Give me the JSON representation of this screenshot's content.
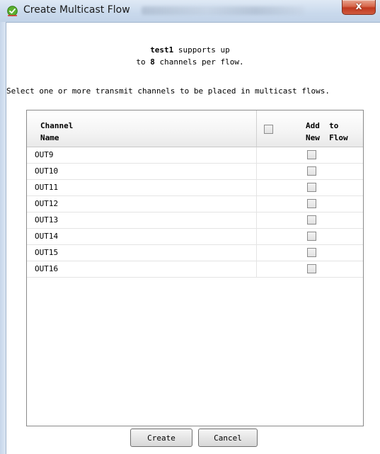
{
  "window": {
    "title": "Create Multicast Flow",
    "close_label": "x",
    "icon": "check-badge-icon"
  },
  "info": {
    "device_name": "test1",
    "line1_suffix": " supports up",
    "line2_prefix": "to ",
    "channel_limit": "8",
    "line2_suffix": " channels per flow."
  },
  "instruction": "Select one or more transmit channels to be placed in multicast flows.",
  "table": {
    "col_channel": "Channel\nName",
    "col_add_line1": "Add  to",
    "col_add_line2": "New  Flow",
    "rows": [
      {
        "name": "OUT9",
        "checked": false
      },
      {
        "name": "OUT10",
        "checked": false
      },
      {
        "name": "OUT11",
        "checked": false
      },
      {
        "name": "OUT12",
        "checked": false
      },
      {
        "name": "OUT13",
        "checked": false
      },
      {
        "name": "OUT14",
        "checked": false
      },
      {
        "name": "OUT15",
        "checked": false
      },
      {
        "name": "OUT16",
        "checked": false
      }
    ]
  },
  "buttons": {
    "create": "Create",
    "cancel": "Cancel"
  },
  "colors": {
    "close_button": "#c0391f",
    "titlebar": "#c9d9ec"
  }
}
